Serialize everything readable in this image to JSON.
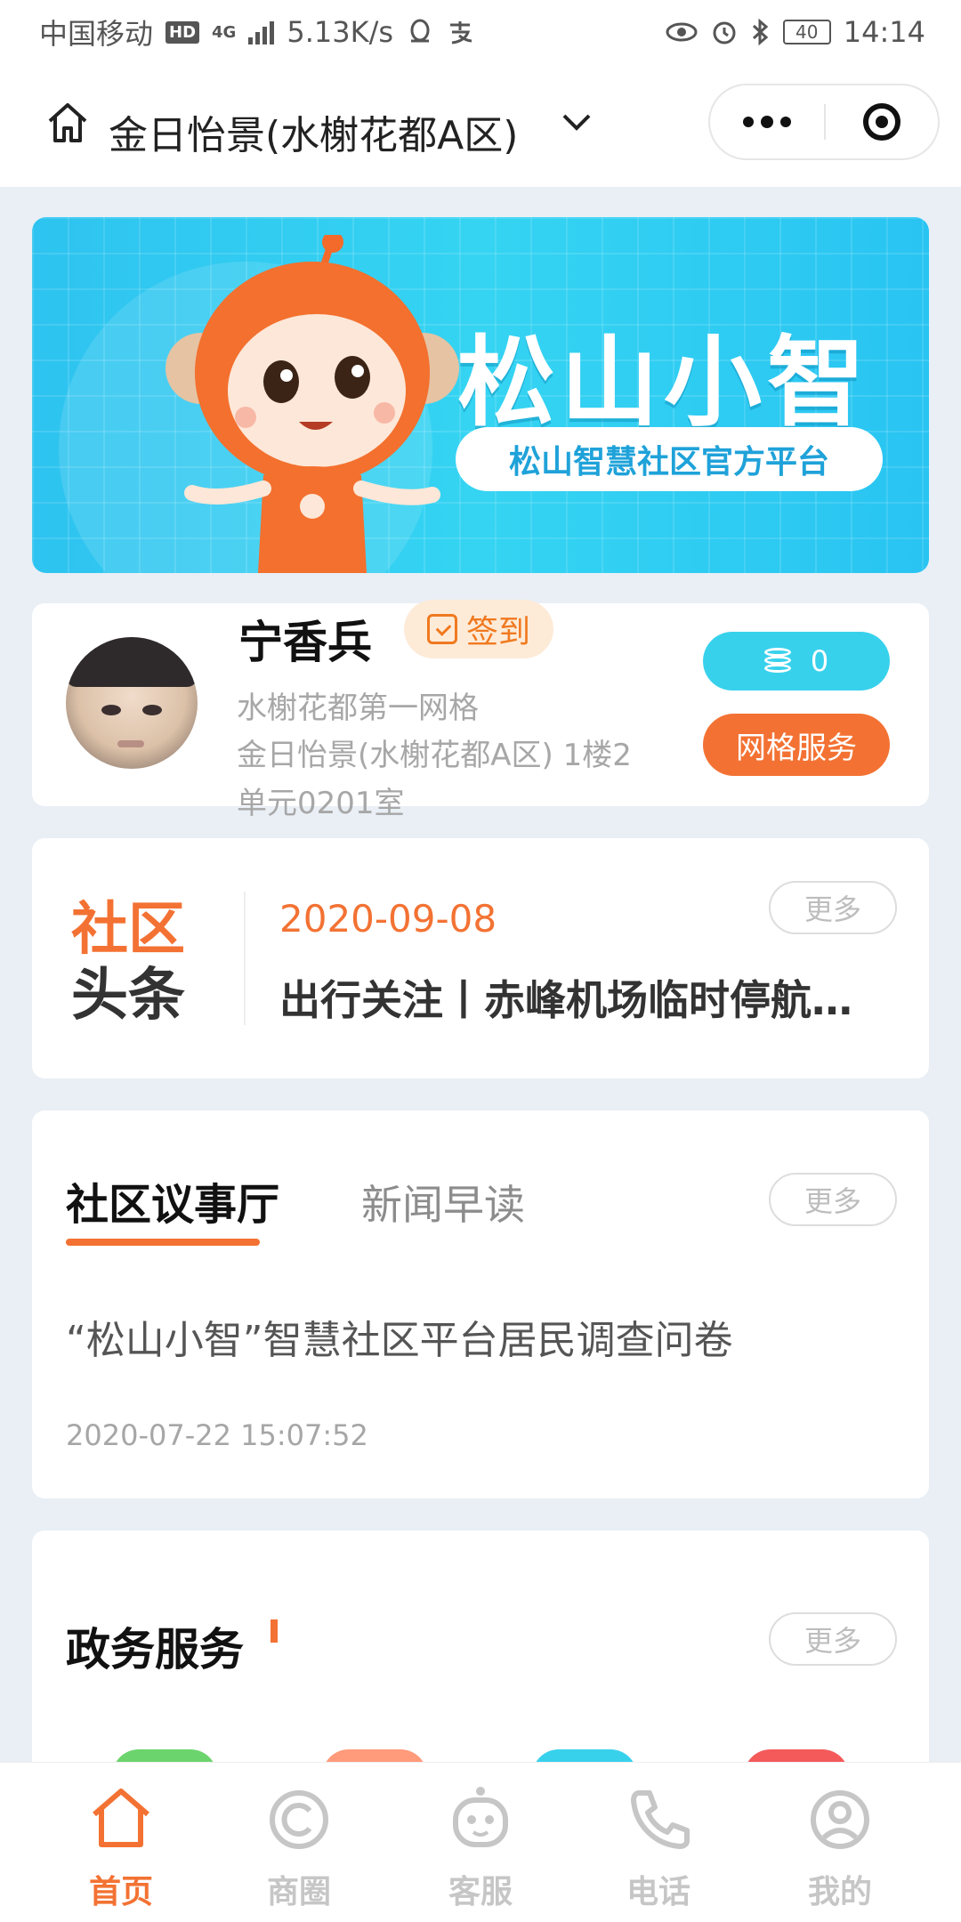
{
  "status_bar": {
    "carrier": "中国移动",
    "hd": "HD",
    "network": "4G",
    "speed": "5.13K/s",
    "battery": "40",
    "time": "14:14"
  },
  "header": {
    "title": "金日怡景(水榭花都A区)"
  },
  "banner": {
    "title": "松山小智",
    "subtitle": "松山智慧社区官方平台"
  },
  "profile": {
    "name": "宁香兵",
    "checkin_label": "签到",
    "grid": "水榭花都第一网格",
    "address": "金日怡景(水榭花都A区) 1楼2单元0201室",
    "points": "0",
    "grid_service_label": "网格服务"
  },
  "headline": {
    "logo_line1": "社区",
    "logo_line2": "头条",
    "date": "2020-09-08",
    "title": "出行关注丨赤峰机场临时停航…",
    "more_label": "更多"
  },
  "council": {
    "tabs": [
      "社区议事厅",
      "新闻早读"
    ],
    "more_label": "更多",
    "item_title": "“松山小智”智慧社区平台居民调查问卷",
    "item_time": "2020-07-22 15:07:52"
  },
  "gov_services": {
    "title": "政务服务",
    "more_label": "更多",
    "icon_colors": [
      "#6cd46c",
      "#ff9a7a",
      "#38d1ec",
      "#f45a5a"
    ]
  },
  "tabbar": {
    "items": [
      {
        "label": "首页",
        "icon": "home-icon",
        "active": true
      },
      {
        "label": "商圈",
        "icon": "shop-circle-icon",
        "active": false
      },
      {
        "label": "客服",
        "icon": "robot-icon",
        "active": false
      },
      {
        "label": "电话",
        "icon": "phone-icon",
        "active": false
      },
      {
        "label": "我的",
        "icon": "user-icon",
        "active": false
      }
    ]
  },
  "colors": {
    "accent": "#f37233",
    "cyan": "#38d1ec",
    "inactive": "#c6c6c6"
  }
}
